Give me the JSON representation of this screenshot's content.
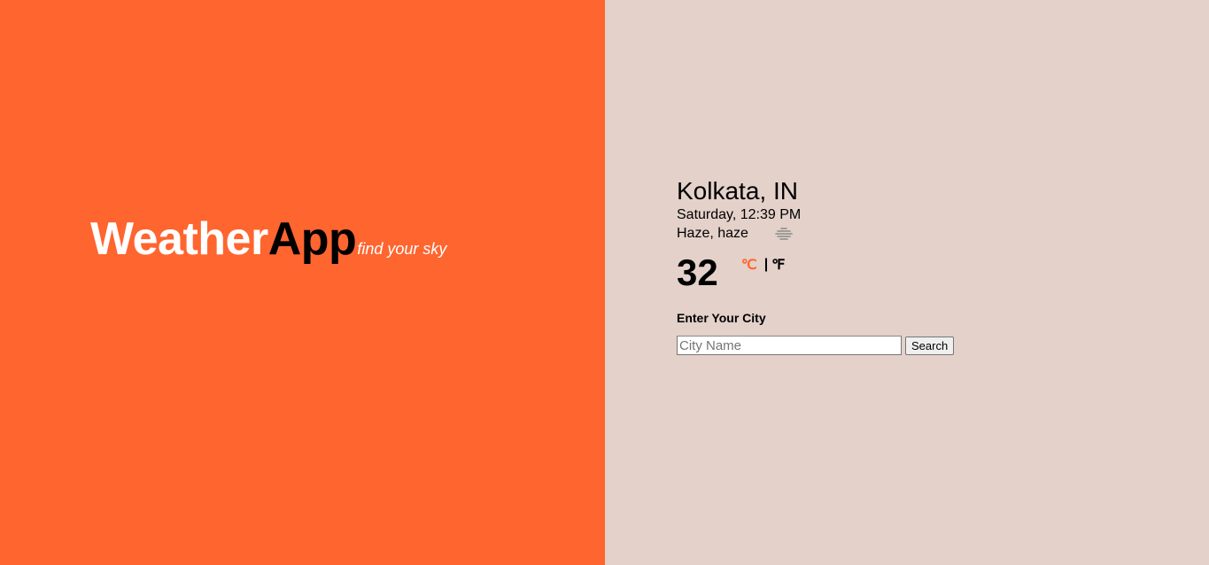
{
  "brand": {
    "name_part1": "Weather",
    "name_part2": "App",
    "tagline": "find your sky"
  },
  "weather": {
    "city": "Kolkata, IN",
    "datetime": "Saturday, 12:39 PM",
    "condition": "Haze, haze",
    "condition_icon": "haze-icon",
    "temperature": "32",
    "unit_celsius": "℃",
    "unit_separator": "|",
    "unit_fahrenheit": "℉"
  },
  "search": {
    "label": "Enter Your City",
    "placeholder": "City Name",
    "value": "",
    "button_label": "Search"
  },
  "colors": {
    "accent": "#ff652f",
    "panel_bg": "#e3d1ca"
  }
}
